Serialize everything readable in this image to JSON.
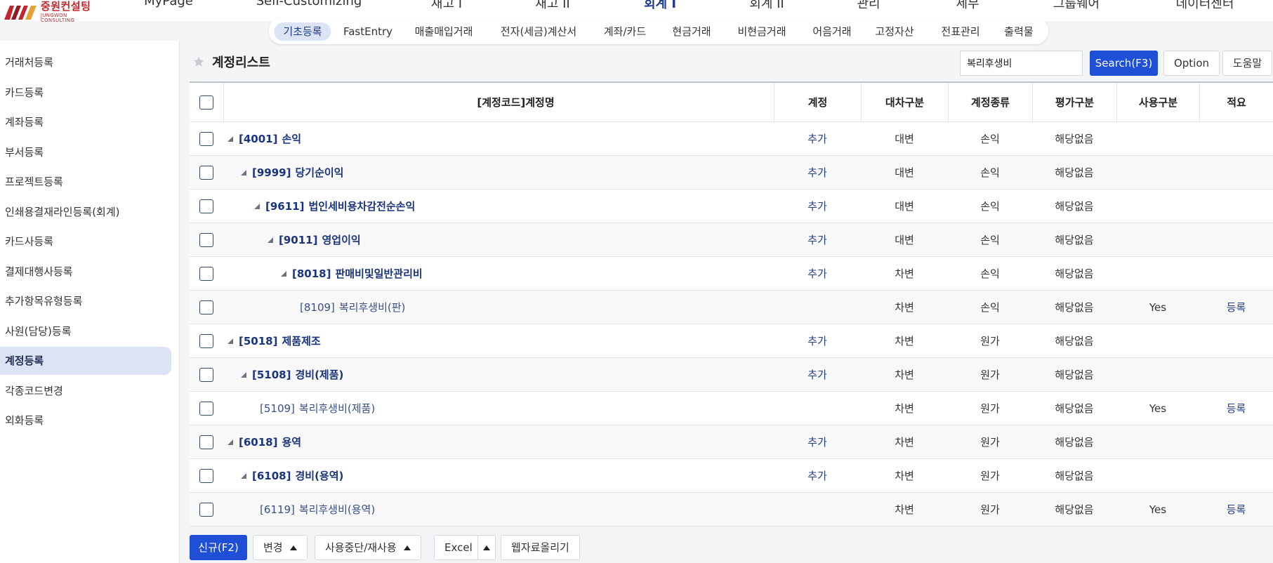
{
  "logo": {
    "kr": "중원컨설팅",
    "en": "JUNGWON CONSULTING"
  },
  "main_nav": [
    {
      "label": "MyPage",
      "active": false
    },
    {
      "label": "Self-Customizing",
      "active": false
    },
    {
      "label": "재고 I",
      "active": false
    },
    {
      "label": "재고 II",
      "active": false
    },
    {
      "label": "회계 I",
      "active": true
    },
    {
      "label": "회계 II",
      "active": false
    },
    {
      "label": "관리",
      "active": false
    },
    {
      "label": "세무",
      "active": false
    },
    {
      "label": "그룹웨어",
      "active": false
    },
    {
      "label": "데이터센터",
      "active": false
    }
  ],
  "sub_nav": [
    {
      "label": "기초등록",
      "active": true
    },
    {
      "label": "FastEntry",
      "active": false
    },
    {
      "label": "매출매입거래",
      "active": false
    },
    {
      "label": "전자(세금)계산서",
      "active": false
    },
    {
      "label": "계좌/카드",
      "active": false
    },
    {
      "label": "현금거래",
      "active": false
    },
    {
      "label": "비현금거래",
      "active": false
    },
    {
      "label": "어음거래",
      "active": false
    },
    {
      "label": "고정자산",
      "active": false
    },
    {
      "label": "전표관리",
      "active": false
    },
    {
      "label": "출력물",
      "active": false
    }
  ],
  "sidebar": {
    "items": [
      {
        "label": "거래처등록",
        "active": false
      },
      {
        "label": "카드등록",
        "active": false
      },
      {
        "label": "계좌등록",
        "active": false
      },
      {
        "label": "부서등록",
        "active": false
      },
      {
        "label": "프로젝트등록",
        "active": false
      },
      {
        "label": "인쇄용결재라인등록(회계)",
        "active": false
      },
      {
        "label": "카드사등록",
        "active": false
      },
      {
        "label": "결제대행사등록",
        "active": false
      },
      {
        "label": "추가항목유형등록",
        "active": false
      },
      {
        "label": "사원(담당)등록",
        "active": false
      },
      {
        "label": "계정등록",
        "active": true
      },
      {
        "label": "각종코드변경",
        "active": false
      },
      {
        "label": "외화등록",
        "active": false
      }
    ]
  },
  "page": {
    "title": "계정리스트"
  },
  "search": {
    "value": "복리후생비",
    "button": "Search(F3)",
    "option": "Option",
    "help": "도움말"
  },
  "grid": {
    "columns": [
      "[계정코드]계정명",
      "계정",
      "대차구분",
      "계정종류",
      "평가구분",
      "사용구분",
      "적요"
    ],
    "rows": [
      {
        "level": 0,
        "leaf": false,
        "code": "[4001]",
        "name": "손익",
        "account": "추가",
        "side": "대변",
        "type": "손익",
        "eval": "해당없음",
        "use": "",
        "memo": ""
      },
      {
        "level": 1,
        "leaf": false,
        "code": "[9999]",
        "name": "당기순이익",
        "account": "추가",
        "side": "대변",
        "type": "손익",
        "eval": "해당없음",
        "use": "",
        "memo": ""
      },
      {
        "level": 2,
        "leaf": false,
        "code": "[9611]",
        "name": "법인세비용차감전순손익",
        "account": "추가",
        "side": "대변",
        "type": "손익",
        "eval": "해당없음",
        "use": "",
        "memo": ""
      },
      {
        "level": 3,
        "leaf": false,
        "code": "[9011]",
        "name": "영업이익",
        "account": "추가",
        "side": "대변",
        "type": "손익",
        "eval": "해당없음",
        "use": "",
        "memo": ""
      },
      {
        "level": 4,
        "leaf": false,
        "code": "[8018]",
        "name": "판매비및일반관리비",
        "account": "추가",
        "side": "차변",
        "type": "손익",
        "eval": "해당없음",
        "use": "",
        "memo": ""
      },
      {
        "level": 5,
        "leaf": true,
        "code": "[8109]",
        "name": "복리후생비(판)",
        "account": "",
        "side": "차변",
        "type": "손익",
        "eval": "해당없음",
        "use": "Yes",
        "memo": "등록"
      },
      {
        "level": 0,
        "leaf": false,
        "code": "[5018]",
        "name": "제품제조",
        "account": "추가",
        "side": "차변",
        "type": "원가",
        "eval": "해당없음",
        "use": "",
        "memo": ""
      },
      {
        "level": 1,
        "leaf": false,
        "code": "[5108]",
        "name": "경비(제품)",
        "account": "추가",
        "side": "차변",
        "type": "원가",
        "eval": "해당없음",
        "use": "",
        "memo": ""
      },
      {
        "level": 2,
        "leaf": true,
        "code": "[5109]",
        "name": "복리후생비(제품)",
        "account": "",
        "side": "차변",
        "type": "원가",
        "eval": "해당없음",
        "use": "Yes",
        "memo": "등록"
      },
      {
        "level": 0,
        "leaf": false,
        "code": "[6018]",
        "name": "용역",
        "account": "추가",
        "side": "차변",
        "type": "원가",
        "eval": "해당없음",
        "use": "",
        "memo": ""
      },
      {
        "level": 1,
        "leaf": false,
        "code": "[6108]",
        "name": "경비(용역)",
        "account": "추가",
        "side": "차변",
        "type": "원가",
        "eval": "해당없음",
        "use": "",
        "memo": ""
      },
      {
        "level": 2,
        "leaf": true,
        "code": "[6119]",
        "name": "복리후생비(용역)",
        "account": "",
        "side": "차변",
        "type": "원가",
        "eval": "해당없음",
        "use": "Yes",
        "memo": "등록"
      }
    ]
  },
  "bottom": {
    "new": "신규(F2)",
    "change": "변경",
    "suspend": "사용중단/재사용",
    "excel": "Excel",
    "upload": "웹자료올리기"
  },
  "colors": {
    "primary": "#1f4fd6",
    "active_bg": "#dce3f5",
    "link": "#24408f",
    "brand": "#c1272d"
  }
}
